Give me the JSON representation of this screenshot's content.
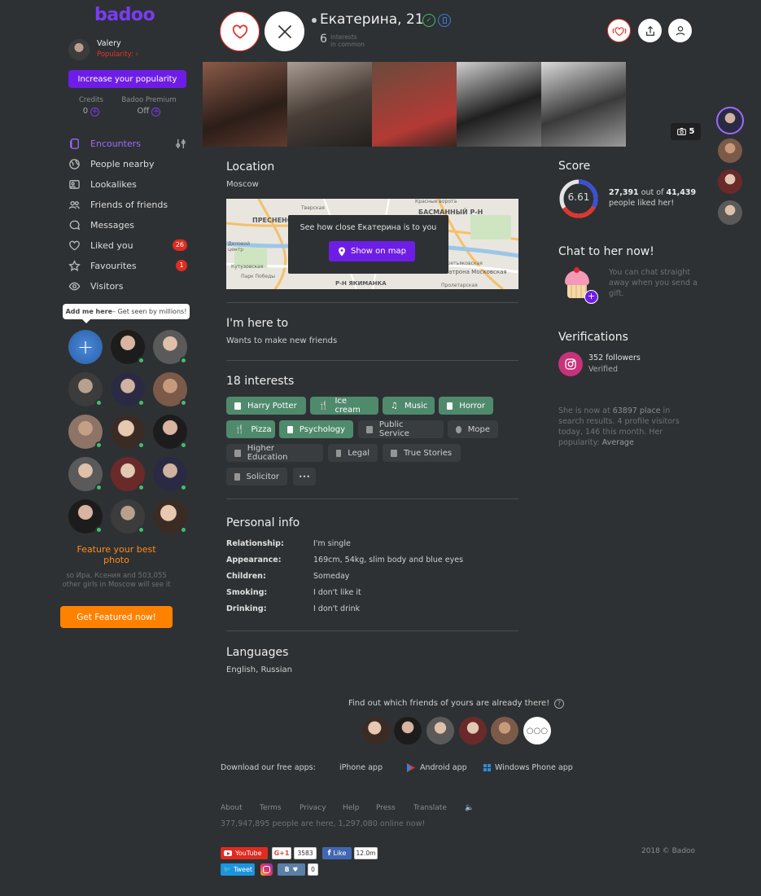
{
  "brand": {
    "logo_text": "badoo",
    "color": "#7a3cf5"
  },
  "user": {
    "name": "Valery",
    "popularity_label": "Popularity:",
    "popularity_arrow": "›"
  },
  "increase_btn": "Increase your popularity",
  "credits": {
    "label": "Credits",
    "value": "0"
  },
  "premium": {
    "label": "Badoo Premium",
    "value": "Off"
  },
  "nav": [
    {
      "label": "Encounters",
      "icon": "cards-icon",
      "active": true
    },
    {
      "label": "People nearby",
      "icon": "globe-icon"
    },
    {
      "label": "Lookalikes",
      "icon": "lookalikes-icon"
    },
    {
      "label": "Friends of friends",
      "icon": "friends-icon"
    },
    {
      "label": "Messages",
      "icon": "chat-bubble-icon"
    },
    {
      "label": "Liked you",
      "icon": "heart-icon",
      "badge": "26"
    },
    {
      "label": "Favourites",
      "icon": "star-icon",
      "badge": "1"
    },
    {
      "label": "Visitors",
      "icon": "eye-icon"
    }
  ],
  "add_me": {
    "bold": "Add me here",
    "rest": " – Get seen by millions!"
  },
  "feature": {
    "title": "Feature your best photo",
    "text": "so Ира, Ксения and 503,055 other girls in Moscow will see it",
    "button": "Get Featured now!"
  },
  "profile": {
    "name": "Екатерина, 21",
    "interests_count": "6",
    "interests_label_1": "interests",
    "interests_label_2": "in common",
    "photo_count": "5"
  },
  "location": {
    "title": "Location",
    "city": "Moscow",
    "map_prompt": "See how close Екатерина is to you",
    "map_button": "Show on map",
    "map_labels": [
      "ПРЕСНЕНСКИЙ",
      "Тверская",
      "Красные ворота",
      "БАСМАННЫЙ Р-Н",
      "Деловой центр",
      "Кутузовская",
      "Парк Победы",
      "Р-Н ЯКИМАНКА",
      "Третьяковская",
      "атрона Московская",
      "Пролетарская"
    ]
  },
  "here_to": {
    "title": "I'm here to",
    "text": "Wants to make new friends"
  },
  "interests": {
    "title": "18 interests",
    "items": [
      {
        "label": "Harry Potter",
        "common": true
      },
      {
        "label": "Ice cream",
        "common": true
      },
      {
        "label": "Music",
        "common": true
      },
      {
        "label": "Horror",
        "common": true
      },
      {
        "label": "Pizza",
        "common": true
      },
      {
        "label": "Psychology",
        "common": true
      },
      {
        "label": "Public Service",
        "common": false
      },
      {
        "label": "Море",
        "common": false
      },
      {
        "label": "Higher Education",
        "common": false
      },
      {
        "label": "Legal",
        "common": false
      },
      {
        "label": "True Stories",
        "common": false
      },
      {
        "label": "Solicitor",
        "common": false
      }
    ],
    "more": "•••"
  },
  "personal": {
    "title": "Personal info",
    "rows": [
      {
        "k": "Relationship:",
        "v": "I'm single"
      },
      {
        "k": "Appearance:",
        "v": "169cm, 54kg, slim body and blue eyes"
      },
      {
        "k": "Children:",
        "v": "Someday"
      },
      {
        "k": "Smoking:",
        "v": "I don't like it"
      },
      {
        "k": "Drinking:",
        "v": "I don't drink"
      }
    ]
  },
  "languages": {
    "title": "Languages",
    "text": "English, Russian"
  },
  "score": {
    "title": "Score",
    "value": "6.61",
    "liked": "27,391",
    "mid": " out of ",
    "total": "41,439",
    "tail": "people liked her!",
    "fraction": 0.661
  },
  "chat": {
    "title": "Chat to her now!",
    "text": "You can chat straight away when you send a gift."
  },
  "verifications": {
    "title": "Verifications",
    "followers": "352 followers",
    "status": "Verified"
  },
  "stats": {
    "text_a": "She is now at ",
    "place": "63897 place",
    "text_b": " in search results. 4 profile visitors today, 146 this month. Her popularity: ",
    "popularity": "Average"
  },
  "friends_prompt": "Find out which friends of yours are already there!",
  "apps": {
    "label": "Download our free apps:",
    "iphone": "iPhone app",
    "android": "Android app",
    "windows": "Windows Phone app"
  },
  "footer": {
    "links": [
      "About",
      "Terms",
      "Privacy",
      "Help",
      "Press",
      "Translate"
    ],
    "online": "377,947,895 people are here, 1,297,080 online now!",
    "copyright": "2018 © Badoo"
  },
  "social": {
    "youtube": "YouTube",
    "gplus": "G+1",
    "gplus_count": "3583",
    "fb_like": "Like",
    "fb_count": "12.0m",
    "tweet": "Tweet",
    "vk": "B",
    "vk_count": "0"
  }
}
